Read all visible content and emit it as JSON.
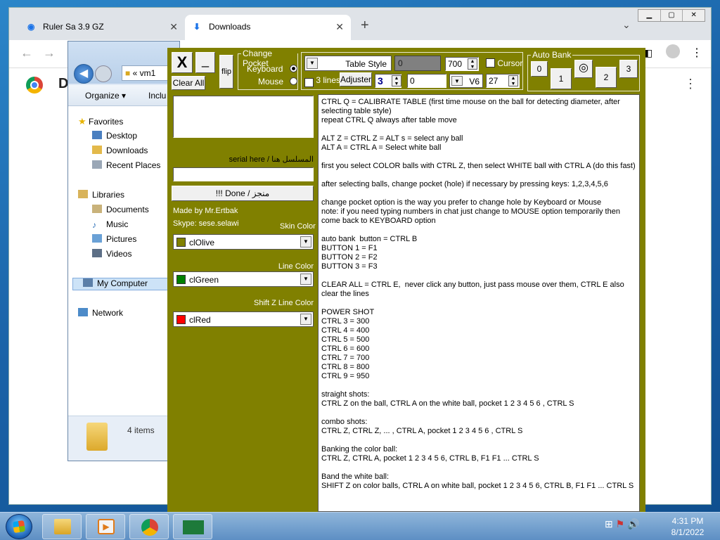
{
  "browser": {
    "tabs": [
      {
        "label": "Ruler Sa 3.9 GZ"
      },
      {
        "label": "Downloads"
      }
    ],
    "new_tab": "+",
    "page_letter": "D"
  },
  "explorer": {
    "address": "vm1",
    "address_chevrons": "«",
    "organize": "Organize ▾",
    "include": "Inclu",
    "nav": {
      "favorites": "Favorites",
      "desktop": "Desktop",
      "downloads": "Downloads",
      "recent": "Recent Places",
      "libraries": "Libraries",
      "documents": "Documents",
      "music": "Music",
      "pictures": "Pictures",
      "videos": "Videos",
      "computer": "My Computer",
      "network": "Network"
    },
    "items_count": "4 items"
  },
  "tool": {
    "close_label": "X",
    "minimize_label": "_",
    "clear_all_label": "Clear All",
    "flip_label": "flip",
    "change_pocket": {
      "title": "Change Pocket",
      "keyboard": "Keyboard",
      "mouse": "Mouse",
      "selected": "keyboard"
    },
    "table_style": {
      "label": "Table Style",
      "value_field": "0",
      "spin_value": "700",
      "cursor_label": "Cursor",
      "cursor_checked": false,
      "three_lines_label": "3 lines",
      "three_lines_checked": true,
      "adjuster_label": "Adjuster",
      "lines_value": "3",
      "offset_value": "0",
      "version_label": "V6",
      "version_value": "27"
    },
    "auto_bank": {
      "title": "Auto Bank",
      "buttons": [
        "0",
        "1",
        "2",
        "3"
      ]
    },
    "serial_label": "serial here / المسلسل هنا",
    "serial_value": "",
    "done_label": "!!! Done / منجز",
    "made_by": "Made by Mr.Ertbak",
    "skype": "Skype: sese.selawi",
    "skin_color": {
      "label": "Skin Color",
      "value": "clOlive",
      "swatch": "#808000"
    },
    "line_color": {
      "label": "Line Color",
      "value": "clGreen",
      "swatch": "#008000"
    },
    "shiftz_color": {
      "label": "Shift Z Line Color",
      "value": "clRed",
      "swatch": "#ff0000"
    },
    "help_text": "CTRL Q = CALIBRATE TABLE (first time mouse on the ball for detecting diameter, after selecting table style)\nrepeat CTRL Q always after table move\n\nALT Z = CTRL Z = ALT s = select any ball\nALT A = CTRL A = Select white ball\n\nfirst you select COLOR balls with CTRL Z, then select WHITE ball with CTRL A (do this fast)\n\nafter selecting balls, change pocket (hole) if necessary by pressing keys: 1,2,3,4,5,6\n\nchange pocket option is the way you prefer to change hole by Keyboard or Mouse\nnote: if you need typing numbers in chat just change to MOUSE option temporarily then come back to KEYBOARD option\n\nauto bank  button = CTRL B\nBUTTON 1 = F1\nBUTTON 2 = F2\nBUTTON 3 = F3\n\nCLEAR ALL = CTRL E,  never click any button, just pass mouse over them, CTRL E also clear the lines\n\nPOWER SHOT\nCTRL 3 = 300\nCTRL 4 = 400\nCTRL 5 = 500\nCTRL 6 = 600\nCTRL 7 = 700\nCTRL 8 = 800\nCTRL 9 = 950\n\nstraight shots:\nCTRL Z on the ball, CTRL A on the white ball, pocket 1 2 3 4 5 6 , CTRL S\n\ncombo shots:\nCTRL Z, CTRL Z, ... , CTRL A, pocket 1 2 3 4 5 6 , CTRL S\n\nBanking the color ball:\nCTRL Z, CTRL A, pocket 1 2 3 4 5 6, CTRL B, F1 F1 ... CTRL S\n\nBand the white ball:\nSHIFT Z on color balls, CTRL A on white ball, pocket 1 2 3 4 5 6, CTRL B, F1 F1 ... CTRL S"
  },
  "taskbar": {
    "time": "4:31 PM",
    "date": "8/1/2022"
  }
}
